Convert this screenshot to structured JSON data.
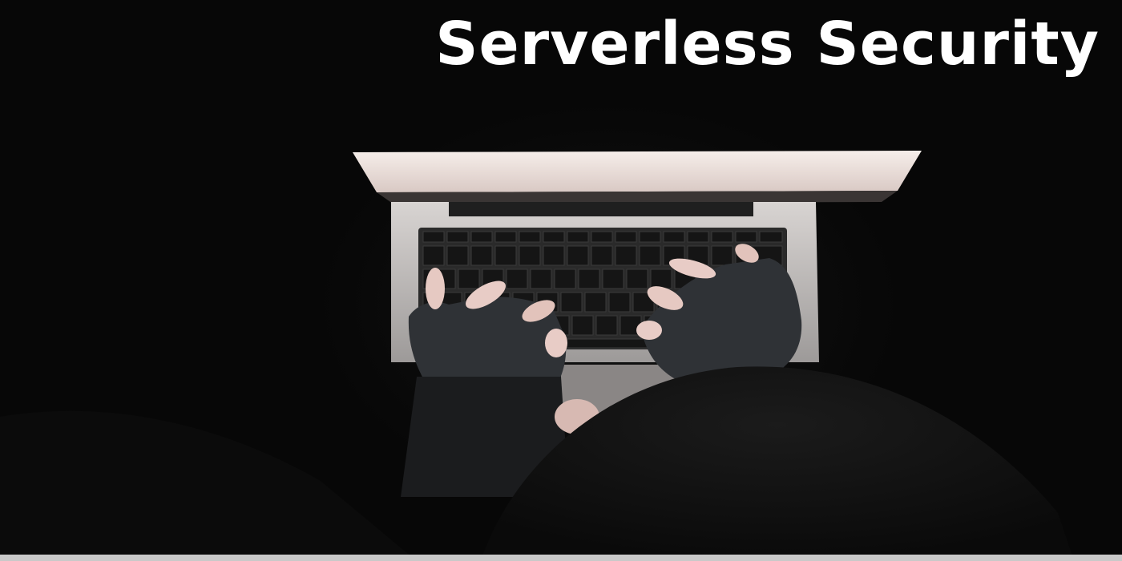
{
  "header": {
    "title": "Serverless Security"
  },
  "image": {
    "subject": "gloved-hands-typing-on-laptop",
    "palette": {
      "background": "#070707",
      "screen": "#f1e6e2",
      "laptop": "#cfcfcf",
      "keys": "#1c1c1c",
      "glove": "#2f3236",
      "skin": "#e8ccc6",
      "title": "#ffffff"
    }
  }
}
